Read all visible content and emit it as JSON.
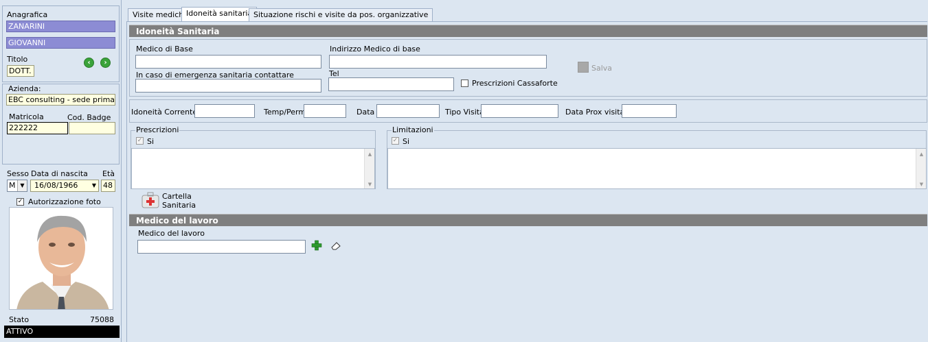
{
  "left": {
    "anagrafica_label": "Anagrafica",
    "surname": "ZANARINI",
    "name": "GIOVANNI",
    "titolo_label": "Titolo",
    "titolo_value": "DOTT.",
    "azienda_label": "Azienda:",
    "azienda_value": "EBC consulting - sede primaria",
    "matricola_label": "Matricola",
    "cod_badge_label": "Cod. Badge",
    "matricola_value": "222222",
    "cod_badge_value": "",
    "sesso_label": "Sesso",
    "sesso_value": "M",
    "nascita_label": "Data di nascita",
    "nascita_value": "16/08/1966",
    "eta_label": "Età",
    "eta_value": "48",
    "autorizzazione_label": "Autorizzazione foto",
    "autorizzazione_checked": "✓",
    "stato_label": "Stato",
    "stato_number": "75088",
    "stato_value": "ATTIVO"
  },
  "tabs": [
    {
      "label": "Visite mediche"
    },
    {
      "label": "Idoneità sanitaria"
    },
    {
      "label": "Situazione rischi e visite da pos. organizzative"
    }
  ],
  "idoneita": {
    "header": "Idoneità Sanitaria",
    "medico_base_label": "Medico di Base",
    "medico_base_value": "",
    "indirizzo_label": "Indirizzo Medico di base",
    "indirizzo_value": "",
    "emergenza_label": "In caso di emergenza sanitaria contattare",
    "emergenza_value": "",
    "tel_label": "Tel",
    "tel_value": "",
    "cassaforte_label": "Prescrizioni Cassaforte",
    "salva_label": "Salva",
    "corrente_label": "Idoneità Corrente",
    "temp_label": "Temp/Perm",
    "data_label": "Data",
    "tipo_label": "Tipo Visita",
    "prox_label": "Data Prox visita",
    "prescrizioni_label": "Prescrizioni",
    "prescrizioni_si": "Si",
    "limitazioni_label": "Limitazioni",
    "limitazioni_si": "Si",
    "cartella_label_1": "Cartella",
    "cartella_label_2": "Sanitaria"
  },
  "lavoro": {
    "header": "Medico del lavoro",
    "medico_label": "Medico del lavoro",
    "medico_value": ""
  },
  "colors": {
    "accent_purple": "#8c8cd4",
    "section_header": "#7f7f7f",
    "background": "#dce6f1"
  }
}
